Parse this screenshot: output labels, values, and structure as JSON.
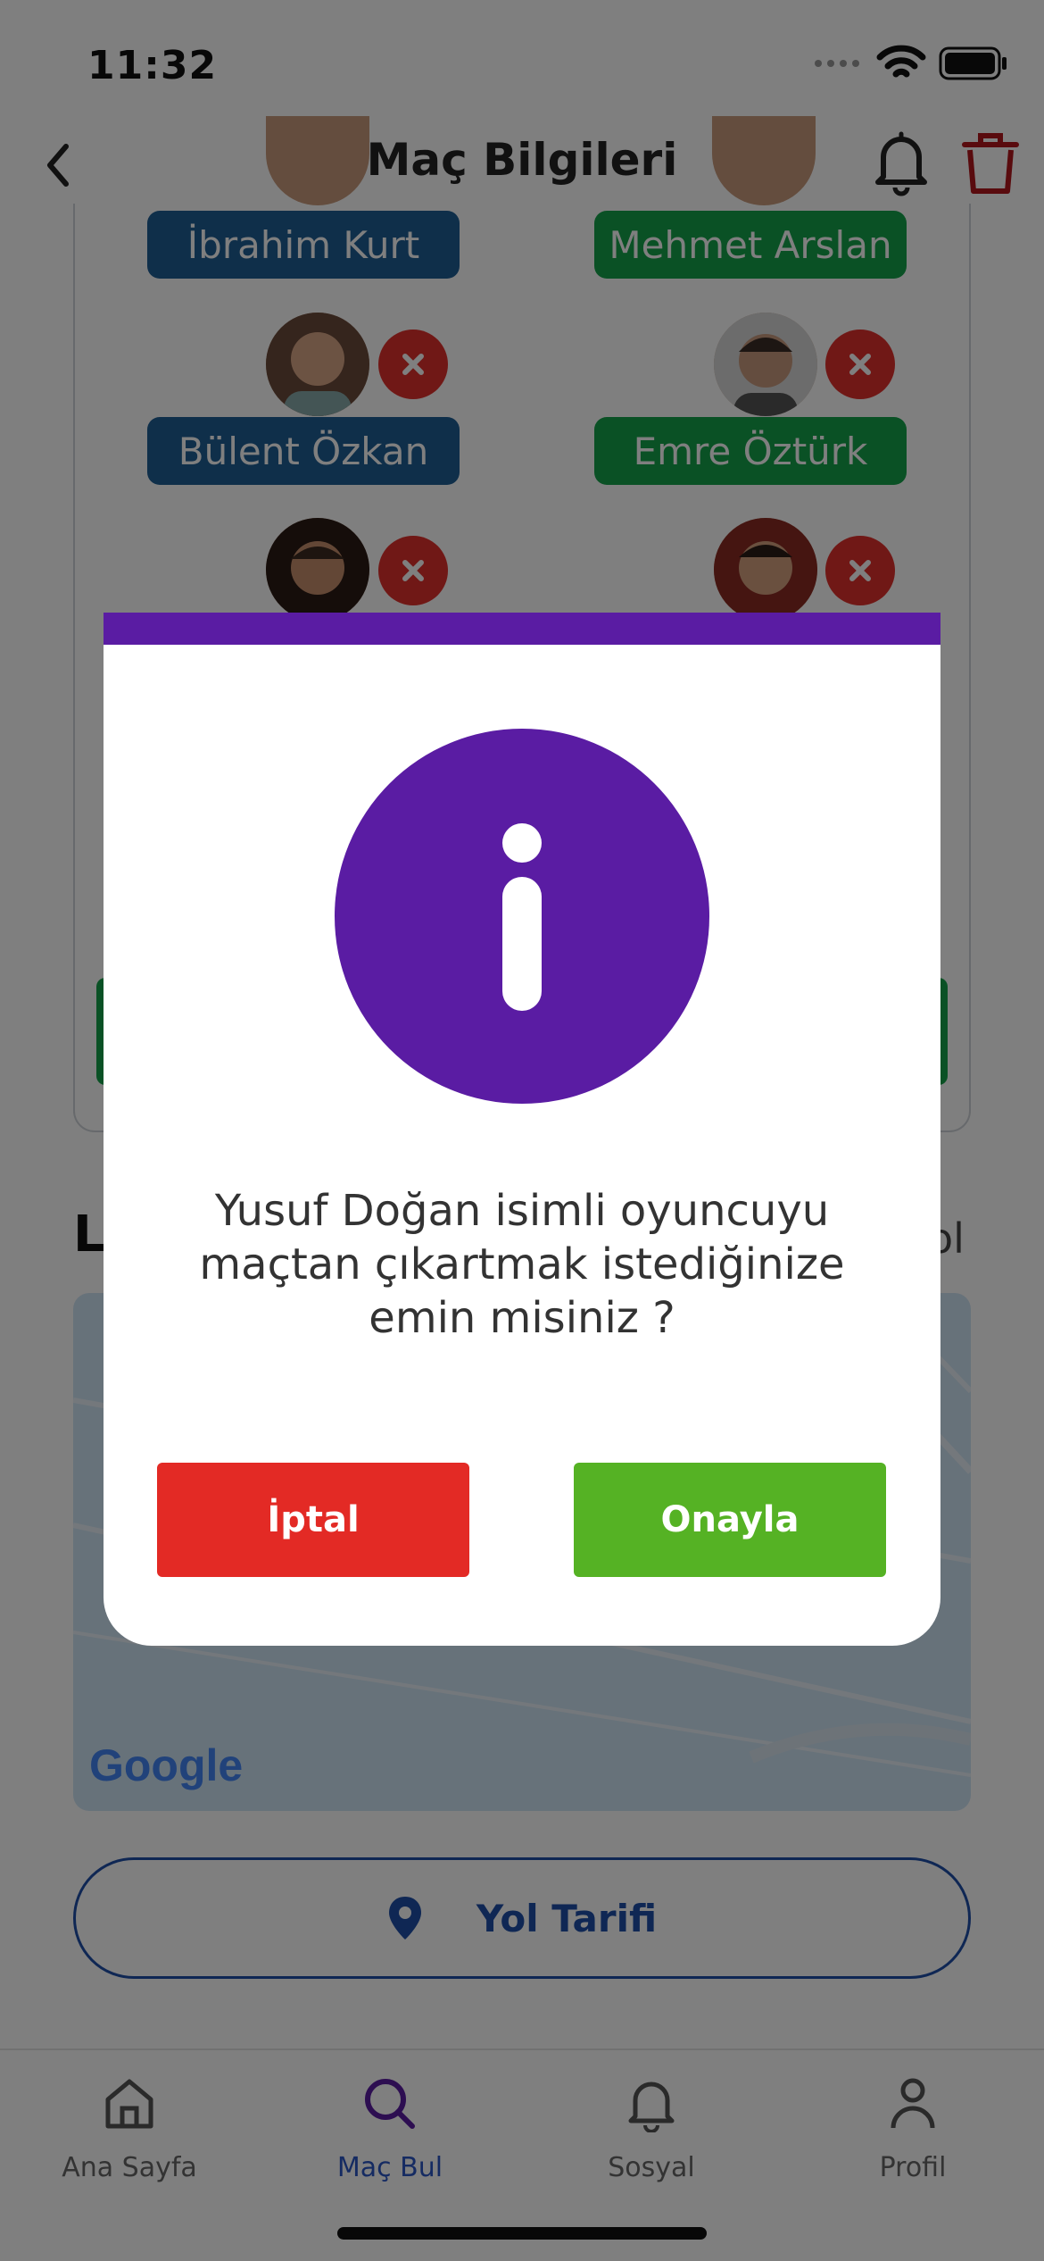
{
  "status_bar": {
    "time": "11:32"
  },
  "nav": {
    "title": "Maç Bilgileri"
  },
  "team_a": [
    {
      "name": "İbrahim Kurt"
    },
    {
      "name": "Bülent Özkan"
    }
  ],
  "team_b": [
    {
      "name": "Mehmet Arslan"
    },
    {
      "name": "Emre Öztürk"
    }
  ],
  "location": {
    "heading": "L",
    "right_text": "ol"
  },
  "map": {
    "logo": "Google"
  },
  "route_button": {
    "label": "Yol Tarifi"
  },
  "tabs": [
    {
      "label": "Ana Sayfa",
      "icon": "home-icon"
    },
    {
      "label": "Maç Bul",
      "icon": "search-icon"
    },
    {
      "label": "Sosyal",
      "icon": "bell-icon"
    },
    {
      "label": "Profil",
      "icon": "person-icon"
    }
  ],
  "dialog": {
    "line1": "Yusuf Doğan isimli oyuncuyu",
    "line2": "maçtan çıkartmak istediğinize",
    "line3": "emin misiniz ?",
    "cancel_label": "İptal",
    "confirm_label": "Onayla"
  },
  "colors": {
    "accent": "#5a1ca3",
    "cancel": "#e32a25",
    "confirm": "#55b224",
    "team_a_chip": "#1f5f94",
    "team_b_chip": "#14a34a",
    "remove": "#e0312c",
    "active_tab": "#2b56c4"
  }
}
